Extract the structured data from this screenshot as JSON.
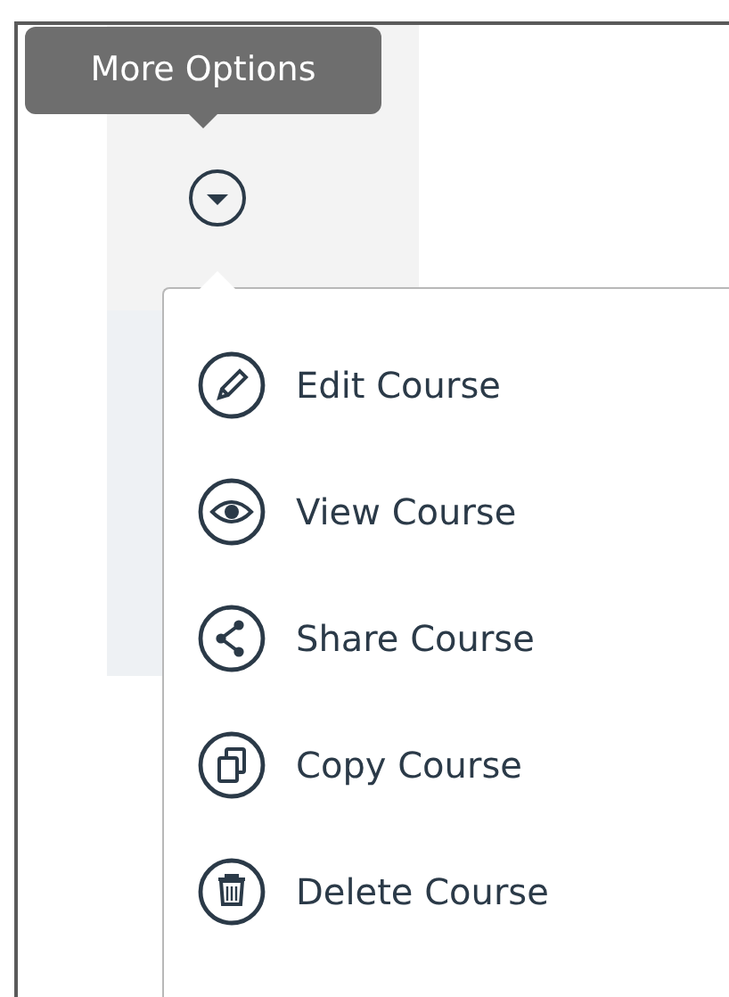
{
  "tooltip": {
    "text": "More Options"
  },
  "menu_items": [
    {
      "kind": "edit",
      "label": "Edit Course"
    },
    {
      "kind": "view",
      "label": "View Course"
    },
    {
      "kind": "share",
      "label": "Share Course"
    },
    {
      "kind": "copy",
      "label": "Copy Course"
    },
    {
      "kind": "delete",
      "label": "Delete Course"
    }
  ]
}
